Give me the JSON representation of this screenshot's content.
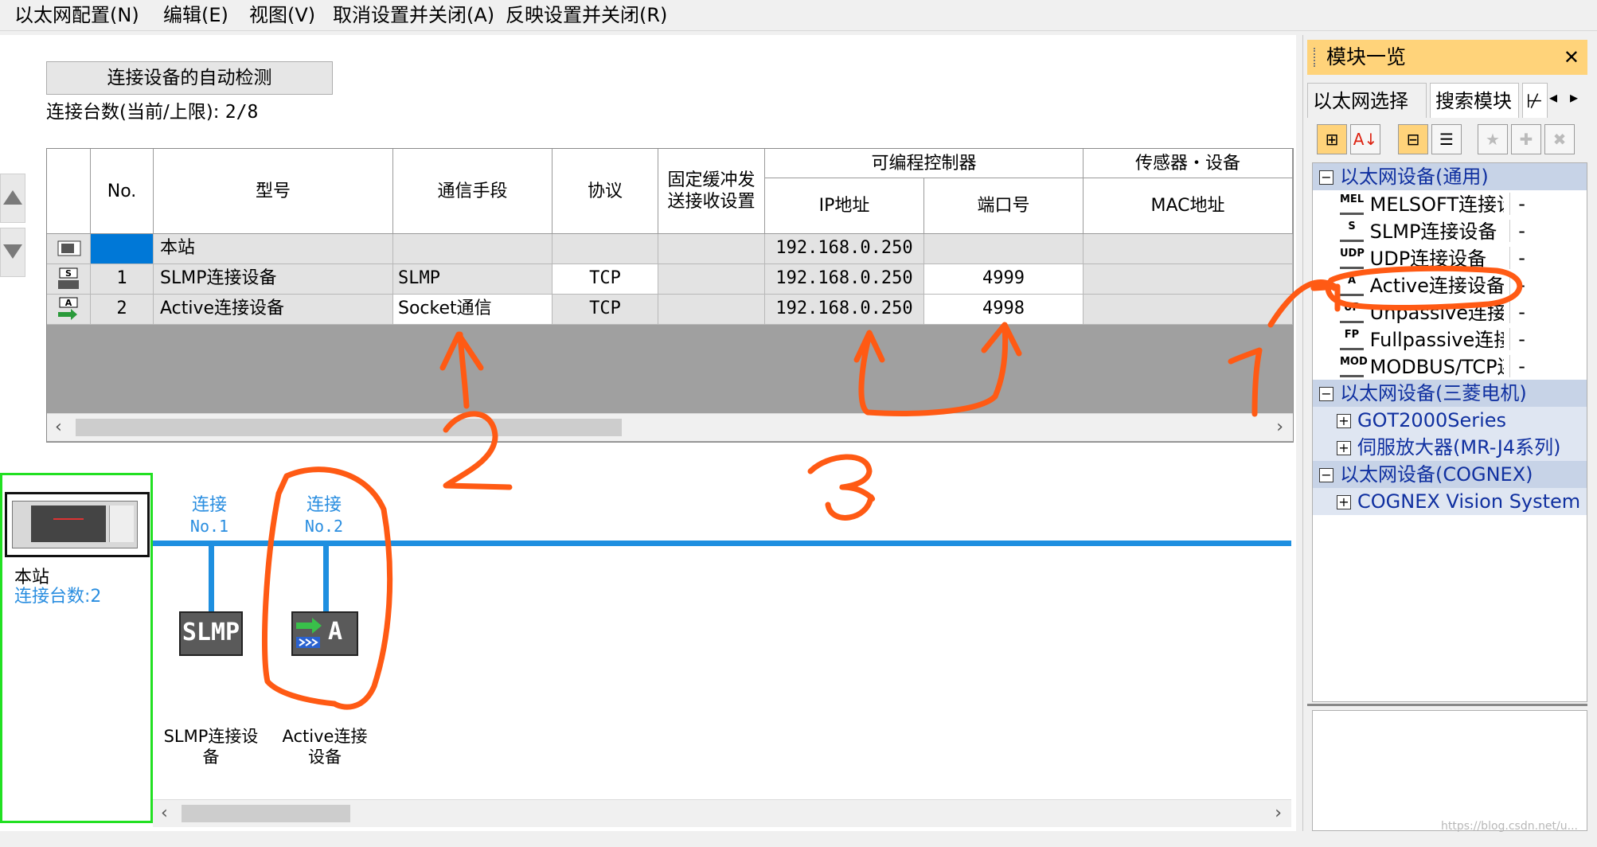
{
  "menu": {
    "items": [
      "以太网配置(N)",
      "编辑(E)",
      "视图(V)",
      "取消设置并关闭(A)",
      "反映设置并关闭(R)"
    ]
  },
  "main": {
    "auto_detect_label": "连接设备的自动检测",
    "connection_count_label": "连接台数(当前/上限):",
    "connection_count_value": "2/8"
  },
  "table": {
    "headers": {
      "no": "No.",
      "model": "型号",
      "comm_method": "通信手段",
      "protocol": "协议",
      "fixed_buffer": "固定缓冲发送接收设置",
      "plc_group": "可编程控制器",
      "ip": "IP地址",
      "port": "端口号",
      "sensor_group": "传感器・设备",
      "mac": "MAC地址"
    },
    "rows": [
      {
        "icon": "host-station-icon",
        "no": "",
        "model": "本站",
        "comm": "",
        "protocol": "",
        "fixed": "",
        "ip": "192.168.0.250",
        "port": "",
        "mac": ""
      },
      {
        "icon": "slmp-device-icon",
        "no": "1",
        "model": "SLMP连接设备",
        "comm": "SLMP",
        "protocol": "TCP",
        "fixed": "",
        "ip": "192.168.0.250",
        "port": "4999",
        "mac": ""
      },
      {
        "icon": "active-device-icon",
        "no": "2",
        "model": "Active连接设备",
        "comm": "Socket通信",
        "protocol": "TCP",
        "fixed": "",
        "ip": "192.168.0.250",
        "port": "4998",
        "mac": ""
      }
    ]
  },
  "diagram": {
    "station_name": "本站",
    "station_count": "连接台数:2",
    "conn1_line1": "连接",
    "conn1_line2": "No.1",
    "conn2_line1": "连接",
    "conn2_line2": "No.2",
    "dev1_badge": "SLMP",
    "dev2_badge": "A",
    "dev1_label_line1": "SLMP连接设",
    "dev1_label_line2": "备",
    "dev2_label_line1": "Active连接",
    "dev2_label_line2": "设备"
  },
  "annotations": {
    "mark1": "1",
    "mark2": "2",
    "mark3": "3",
    "color": "#ff5a14"
  },
  "right_panel": {
    "title": "模块一览",
    "close": "✕",
    "tabs": [
      "以太网选择",
      "搜索模块",
      "⊬"
    ],
    "groups": [
      {
        "label": "以太网设备(通用)",
        "expanded": true,
        "items": [
          {
            "icon_text": "MEL",
            "label": "MELSOFT连接设",
            "val": "-"
          },
          {
            "icon_text": "S",
            "label": "SLMP连接设备",
            "val": "-"
          },
          {
            "icon_text": "UDP",
            "label": "UDP连接设备",
            "val": "-"
          },
          {
            "icon_text": "A",
            "label": "Active连接设备",
            "val": "-"
          },
          {
            "icon_text": "UP",
            "label": "Unpassive连接",
            "val": "-"
          },
          {
            "icon_text": "FP",
            "label": "Fullpassive连接",
            "val": "-"
          },
          {
            "icon_text": "MOD",
            "label": "MODBUS/TCP连接",
            "val": "-"
          }
        ]
      },
      {
        "label": "以太网设备(三菱电机)",
        "expanded": true,
        "items": [
          {
            "label": "GOT2000Series"
          },
          {
            "label": "伺服放大器(MR-J4系列)"
          }
        ]
      },
      {
        "label": "以太网设备(COGNEX)",
        "expanded": true,
        "items": [
          {
            "label": "COGNEX Vision System"
          }
        ]
      }
    ]
  },
  "watermark": "https://blog.csdn.net/u..."
}
